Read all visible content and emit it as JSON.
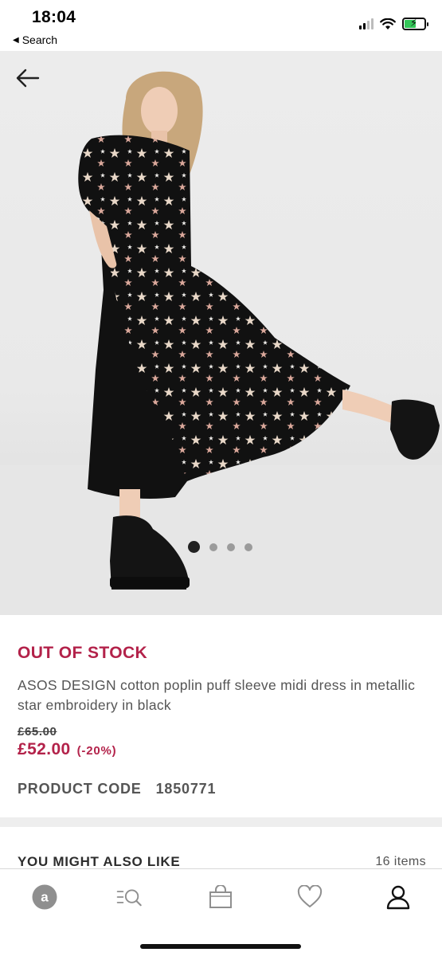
{
  "status_bar": {
    "time": "18:04",
    "back_label": "Search"
  },
  "hero": {
    "image_alt": "Model wearing black midi dress with metallic star embroidery and black chunky boots",
    "carousel": {
      "count": 4,
      "active": 0
    }
  },
  "product": {
    "stock_status": "OUT OF STOCK",
    "title": "ASOS DESIGN cotton poplin puff sleeve midi dress in metallic star embroidery in black",
    "price_old": "£65.00",
    "price_new": "£52.00",
    "discount": "(-20%)",
    "code_label": "PRODUCT CODE",
    "code_value": "1850771"
  },
  "also_like": {
    "title": "YOU MIGHT ALSO LIKE",
    "count": "16 items"
  },
  "bottom_nav": {
    "items": [
      {
        "name": "home",
        "icon": "asos-logo-icon"
      },
      {
        "name": "search",
        "icon": "search-list-icon"
      },
      {
        "name": "bag",
        "icon": "bag-icon"
      },
      {
        "name": "saved",
        "icon": "heart-icon"
      },
      {
        "name": "account",
        "icon": "user-icon"
      }
    ]
  },
  "colors": {
    "accent": "#b3224a",
    "text": "#2d2d2d"
  }
}
